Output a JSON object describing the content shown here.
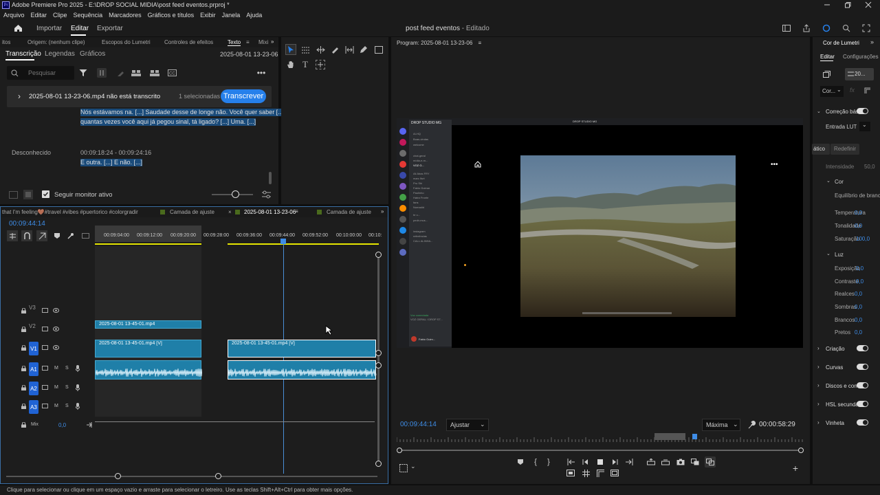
{
  "title_bar": {
    "title": "Adobe Premiere Pro 2025 - E:\\DROP SOCIAL MIDIA\\post feed eventos.prproj *"
  },
  "menu": [
    "Arquivo",
    "Editar",
    "Clipe",
    "Sequência",
    "Marcadores",
    "Gráficos e títulos",
    "Exibir",
    "Janela",
    "Ajuda"
  ],
  "header": {
    "tabs": [
      "Importar",
      "Editar",
      "Exportar"
    ],
    "project": "post feed eventos",
    "status": "- Editado"
  },
  "source_panel": {
    "tabs": [
      "itos",
      "Origem: (nenhum clipe)",
      "Escopos do Lumetri",
      "Controles de efeitos",
      "Texto",
      "Mixi"
    ],
    "subtabs": [
      "Transcrição",
      "Legendas",
      "Gráficos"
    ],
    "date": "2025-08-01 13-23-06",
    "search_placeholder": "Pesquisar",
    "banner_text": "2025-08-01 13-23-06.mp4 não está transcrito",
    "selected": "1 selecionadas",
    "transcribe": "Transcrever",
    "line1": "Nós estávamos na. [...] Saudade desse de longe não. Você quer saber [...]",
    "line2": "quantas vezes você aqui já pegou sinal, tá ligado? [...] Uma. [...]",
    "speaker": "Desconhecido",
    "time_range": "00:09:18:24 - 00:09:24:16",
    "line3": "E outra. [...] E não. [...]",
    "follow_monitor": "Seguir monitor ativo"
  },
  "program": {
    "label": "Program: 2025-08-01 13-23-06",
    "timecode": "00:09:44:14",
    "fit": "Ajustar",
    "quality": "Máxima",
    "duration": "00:00:58:29",
    "discord": {
      "window_title": "DROP STUDIO MG",
      "server_name": "DROP STUDIO MG",
      "channels": [
        "Al-HQ",
        "Boas-vindas",
        "welcome",
        "chat-geral",
        "mídia-e-m...",
        "VOZ G...",
        "Ali Abas FRY",
        "marc lfurt",
        "Pro Shi",
        "Fabio Guimar",
        "Paulinho",
        "Hatra Fronte",
        "fans",
        "Nomadid",
        "te u...",
        "pedir-mus...",
        "instagram",
        "referências",
        "CALL ALINHA..."
      ],
      "voice_status": "Voz conectada",
      "voice_channel": "VOZ GERAL / DROP ST...",
      "user": "Fabio Guim..."
    }
  },
  "timeline": {
    "tabs": [
      "that I'm feeling🤎#travel #vibes #puertorico #colorgrading",
      "Camada de ajuste",
      "2025-08-01 13-23-06",
      "Camada de ajuste"
    ],
    "timecode": "00:09:44:14",
    "ruler": [
      "00:09:04:00",
      "00:09:12:00",
      "00:09:20:00",
      "00:09:28:00",
      "00:09:36:00",
      "00:09:44:00",
      "00:09:52:00",
      "00:10:00:00",
      "00:10:"
    ],
    "tracks": [
      "V3",
      "V2",
      "V1",
      "A1",
      "A2",
      "A3"
    ],
    "mix_label": "Mix",
    "mix_value": "0,0",
    "clips": {
      "v2": "2025-08-01 13-45-01.mp4",
      "v1a": "2025-08-01 13-45-01.mp4 [V]",
      "v1b": "2025-08-01 13-45-01.mp4 [V]"
    }
  },
  "lumetri": {
    "title": "Cor de Lumetri",
    "tabs": [
      "Editar",
      "Configurações"
    ],
    "clip_dropdown": "20...",
    "preset": "Cor...",
    "basic": "Correção básica",
    "lut_label": "Entrada LUT",
    "auto": "ático",
    "reset": "Redefinir",
    "intensity": "Intensidade",
    "intensity_val": "50,0",
    "color_section": "Cor",
    "white_balance": "Equilíbrio de branc",
    "temperature": "Temperatura",
    "temperature_val": "0,0",
    "tint": "Tonalidade",
    "tint_val": "0,0",
    "saturation": "Saturação",
    "saturation_val": "100,0",
    "light_section": "Luz",
    "exposure": "Exposição",
    "exposure_val": "0,0",
    "contrast": "Contraste",
    "contrast_val": "0,0",
    "highlights": "Realces",
    "highlights_val": "0,0",
    "shadows": "Sombras",
    "shadows_val": "0,0",
    "whites": "Brancos",
    "whites_val": "0,0",
    "blacks": "Pretos",
    "blacks_val": "0,0",
    "sections": [
      "Criação",
      "Curvas",
      "Discos e correç",
      "HSL secundár",
      "Vinheta"
    ]
  },
  "status_bar": "Clique para selecionar ou clique em um espaço vazio e arraste para selecionar o letreiro. Use as teclas Shift+Alt+Ctrl para obter mais opções.",
  "colors": {
    "accent": "#2680eb",
    "clip": "#1f7fa8",
    "playhead": "#4a90d9"
  }
}
